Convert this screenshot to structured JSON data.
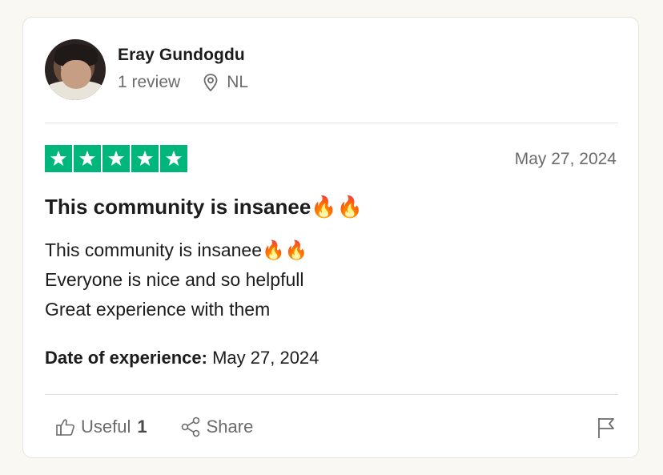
{
  "reviewer": {
    "name": "Eray Gundogdu",
    "review_count": "1 review",
    "country": "NL"
  },
  "rating": {
    "stars": 5,
    "max_stars": 5,
    "color": "#00b67a"
  },
  "review": {
    "date": "May 27, 2024",
    "title": "This community is insanee🔥🔥",
    "body_lines": [
      "This community is insanee🔥🔥",
      "Everyone is nice and so helpfull",
      "Great experience with them"
    ],
    "experience_label": "Date of experience:",
    "experience_date": "May 27, 2024"
  },
  "actions": {
    "useful_label": "Useful",
    "useful_count": "1",
    "share_label": "Share",
    "flag_icon": "flag-icon"
  }
}
